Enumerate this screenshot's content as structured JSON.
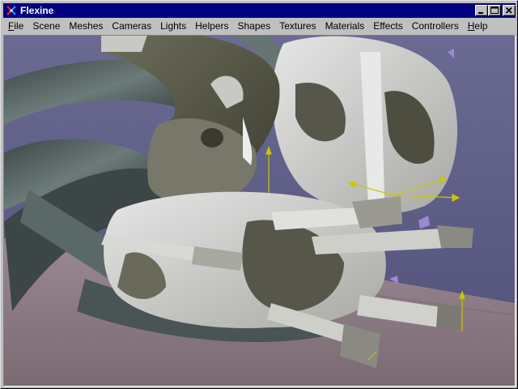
{
  "window": {
    "title": "Flexine",
    "buttons": {
      "minimize": "minimize",
      "maximize": "maximize",
      "close": "close"
    },
    "title_color": "#000080"
  },
  "menubar": {
    "items": [
      {
        "label": "File",
        "underline": "F",
        "rest": "ile"
      },
      {
        "label": "Scene"
      },
      {
        "label": "Meshes"
      },
      {
        "label": "Cameras"
      },
      {
        "label": "Lights"
      },
      {
        "label": "Helpers"
      },
      {
        "label": "Shapes"
      },
      {
        "label": "Textures"
      },
      {
        "label": "Materials"
      },
      {
        "label": "Effects"
      },
      {
        "label": "Controllers"
      },
      {
        "label": "Help",
        "underline": "H",
        "rest": "elp"
      }
    ]
  },
  "viewport": {
    "description_icon": "3d-scene-render",
    "colors": {
      "background": "#5c5c80",
      "floor": "#8e7c86",
      "model_light": "#d8d8d8",
      "model_dark": "#5a5a48",
      "tube": "#4e5a5a",
      "gizmo": "#c8c800"
    }
  }
}
